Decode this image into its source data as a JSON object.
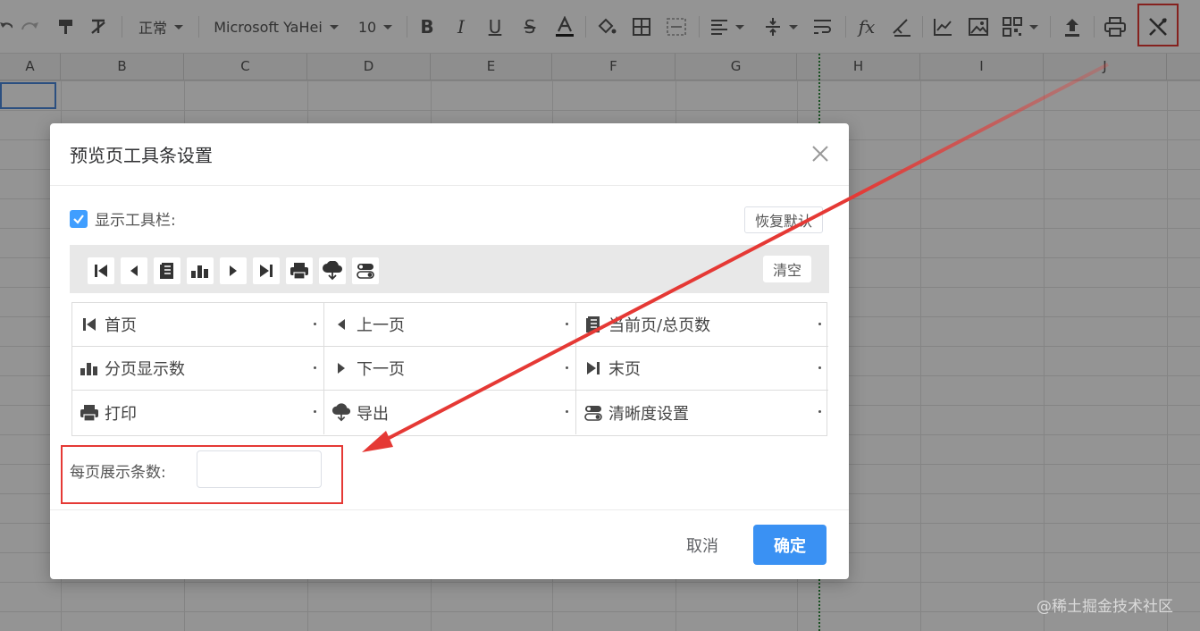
{
  "toolbar": {
    "style_value": "正常",
    "font_value": "Microsoft YaHei",
    "size_value": "10",
    "icons": [
      "undo-icon",
      "redo-icon",
      "format-painter-icon",
      "clear-format-icon",
      "bold-icon",
      "italic-icon",
      "underline-icon",
      "strikethrough-icon",
      "font-color-icon",
      "fill-color-icon",
      "border-icon",
      "merge-icon",
      "align-icon",
      "valign-icon",
      "wrap-icon",
      "function-icon",
      "sign-icon",
      "chart-icon",
      "image-icon",
      "qrcode-icon",
      "upload-icon",
      "print-icon",
      "settings-tools-icon"
    ]
  },
  "columns": [
    "A",
    "B",
    "C",
    "D",
    "E",
    "F",
    "G",
    "H",
    "I",
    "J"
  ],
  "dialog": {
    "title": "预览页工具条设置",
    "show_toolbar_label": "显示工具栏:",
    "show_toolbar_checked": true,
    "restore_label": "恢复默认",
    "clear_label": "清空",
    "options": [
      {
        "label": "首页",
        "icon": "first-page-icon"
      },
      {
        "label": "上一页",
        "icon": "prev-page-icon"
      },
      {
        "label": "当前页/总页数",
        "icon": "page-count-icon"
      },
      {
        "label": "分页显示数",
        "icon": "bar-chart-icon"
      },
      {
        "label": "下一页",
        "icon": "next-page-icon"
      },
      {
        "label": "末页",
        "icon": "last-page-icon"
      },
      {
        "label": "打印",
        "icon": "print-icon"
      },
      {
        "label": "导出",
        "icon": "cloud-download-icon"
      },
      {
        "label": "清晰度设置",
        "icon": "toggle-settings-icon"
      }
    ],
    "per_page_label": "每页展示条数:",
    "per_page_value": "",
    "cancel_label": "取消",
    "confirm_label": "确定"
  },
  "watermark": "@稀土掘金技术社区",
  "colors": {
    "accent": "#409eff",
    "confirm": "#3a91f3",
    "highlight": "#e53935"
  }
}
